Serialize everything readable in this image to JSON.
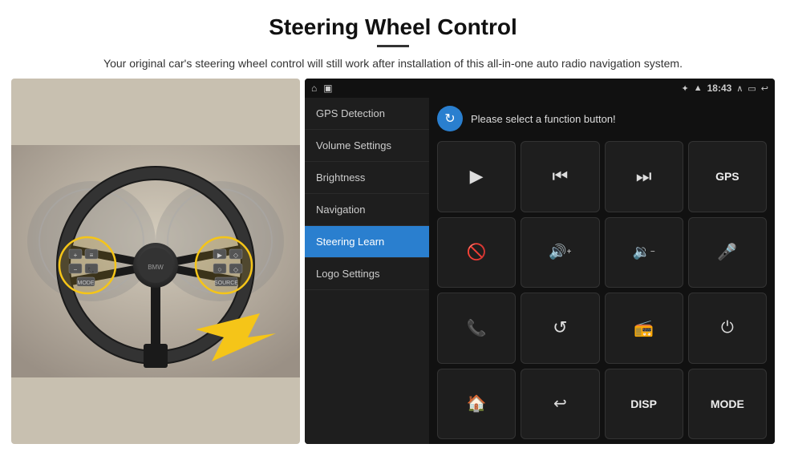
{
  "header": {
    "title": "Steering Wheel Control",
    "subtitle": "Your original car's steering wheel control will still work after installation of this all-in-one auto radio navigation system."
  },
  "status_bar": {
    "time": "18:43",
    "icons_left": [
      "home-icon",
      "image-icon"
    ],
    "icons_right": [
      "bluetooth-icon",
      "wifi-icon",
      "time-label",
      "signal-icon",
      "battery-icon",
      "back-icon"
    ]
  },
  "menu": {
    "items": [
      {
        "label": "GPS Detection",
        "active": false
      },
      {
        "label": "Volume Settings",
        "active": false
      },
      {
        "label": "Brightness",
        "active": false
      },
      {
        "label": "Navigation",
        "active": false
      },
      {
        "label": "Steering Learn",
        "active": true
      },
      {
        "label": "Logo Settings",
        "active": false
      }
    ]
  },
  "function_panel": {
    "header_text": "Please select a function button!",
    "buttons": [
      {
        "id": "play",
        "icon": "▶",
        "type": "icon"
      },
      {
        "id": "prev",
        "icon": "⏮",
        "type": "icon"
      },
      {
        "id": "next",
        "icon": "⏭",
        "type": "icon"
      },
      {
        "id": "gps",
        "icon": "GPS",
        "type": "text"
      },
      {
        "id": "mute",
        "icon": "⊘",
        "type": "icon"
      },
      {
        "id": "vol-up",
        "icon": "🔊+",
        "type": "icon"
      },
      {
        "id": "vol-down",
        "icon": "🔉-",
        "type": "icon"
      },
      {
        "id": "mic",
        "icon": "🎤",
        "type": "icon"
      },
      {
        "id": "phone",
        "icon": "📞",
        "type": "icon"
      },
      {
        "id": "call-rotate",
        "icon": "↺",
        "type": "icon"
      },
      {
        "id": "radio",
        "icon": "📻",
        "type": "icon"
      },
      {
        "id": "power",
        "icon": "⏻",
        "type": "icon"
      },
      {
        "id": "home",
        "icon": "🏠",
        "type": "icon"
      },
      {
        "id": "back",
        "icon": "↩",
        "type": "icon"
      },
      {
        "id": "disp",
        "icon": "DISP",
        "type": "text"
      },
      {
        "id": "mode",
        "icon": "MODE",
        "type": "text"
      }
    ]
  }
}
